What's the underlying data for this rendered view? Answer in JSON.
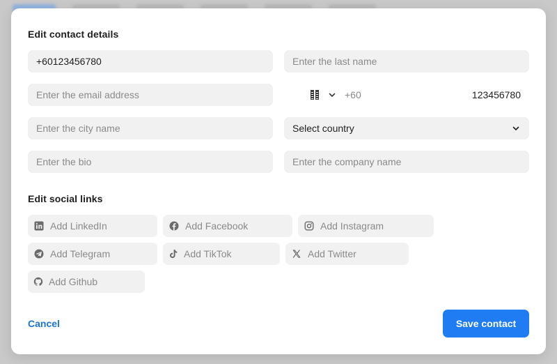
{
  "modal": {
    "contact_title": "Edit contact details",
    "social_title": "Edit social links"
  },
  "contact": {
    "first_name": {
      "value": "+60123456780",
      "placeholder": ""
    },
    "last_name": {
      "value": "",
      "placeholder": "Enter the last name"
    },
    "email": {
      "value": "",
      "placeholder": "Enter the email address"
    },
    "phone": {
      "dial_code": "+60",
      "number": "123456780",
      "country_flag_icon": "flag-icon"
    },
    "city": {
      "value": "",
      "placeholder": "Enter the city name"
    },
    "country": {
      "selected": "Select country"
    },
    "bio": {
      "value": "",
      "placeholder": "Enter the bio"
    },
    "company": {
      "value": "",
      "placeholder": "Enter the company name"
    }
  },
  "social": {
    "linkedin": {
      "placeholder": "Add LinkedIn",
      "icon": "linkedin-icon"
    },
    "facebook": {
      "placeholder": "Add Facebook",
      "icon": "facebook-icon"
    },
    "instagram": {
      "placeholder": "Add Instagram",
      "icon": "instagram-icon"
    },
    "telegram": {
      "placeholder": "Add Telegram",
      "icon": "telegram-icon"
    },
    "tiktok": {
      "placeholder": "Add TikTok",
      "icon": "tiktok-icon"
    },
    "twitter": {
      "placeholder": "Add Twitter",
      "icon": "x-twitter-icon"
    },
    "github": {
      "placeholder": "Add Github",
      "icon": "github-icon"
    }
  },
  "actions": {
    "cancel_label": "Cancel",
    "save_label": "Save contact"
  },
  "colors": {
    "accent": "#1f7cf2",
    "link": "#1a73d9",
    "field_bg": "#f1f1f1",
    "backdrop": "#c9c9c9"
  }
}
